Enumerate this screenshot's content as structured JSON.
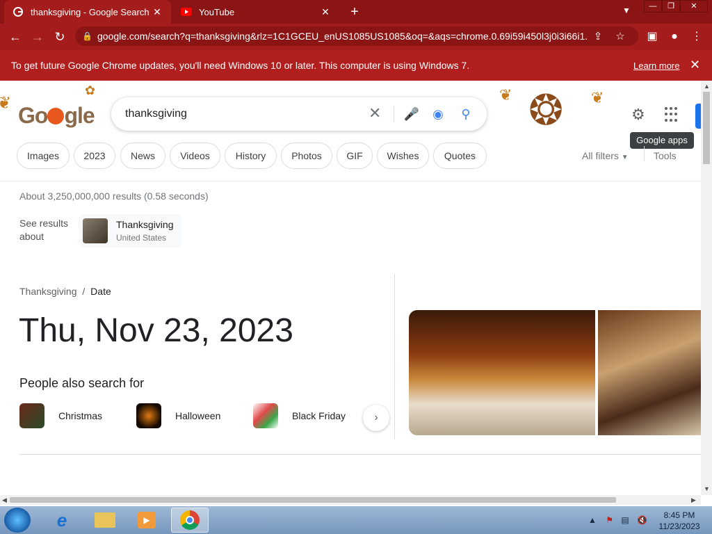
{
  "browser": {
    "tabs": [
      {
        "label": "thanksgiving - Google Search",
        "active": true,
        "favicon": "google-g-icon"
      },
      {
        "label": "YouTube",
        "active": false,
        "favicon": "youtube-icon"
      }
    ],
    "url": "google.com/search?q=thanksgiving&rlz=1C1GCEU_enUS1085US1085&oq=&aqs=chrome.0.69i59i450l3j0i3i66i1...",
    "theme_color": "#a51c1c"
  },
  "infobar": {
    "message": "To get future Google Chrome updates, you'll need Windows 10 or later. This computer is using Windows 7.",
    "link": "Learn more"
  },
  "search": {
    "query": "thanksgiving",
    "tooltip": "Google apps",
    "chips": [
      "Images",
      "2023",
      "News",
      "Videos",
      "History",
      "Photos",
      "GIF",
      "Wishes",
      "Quotes"
    ],
    "all_filters": "All filters",
    "tools": "Tools",
    "result_stats": "About 3,250,000,000 results (0.58 seconds)"
  },
  "see_results": {
    "label": "See results about",
    "entity_name": "Thanksgiving",
    "entity_sub": "United States"
  },
  "answer": {
    "breadcrumb_parent": "Thanksgiving",
    "breadcrumb_sep": "/",
    "breadcrumb_current": "Date",
    "date": "Thu, Nov 23, 2023"
  },
  "people_also_search": {
    "heading": "People also search for",
    "items": [
      "Christmas",
      "Halloween",
      "Black Friday"
    ]
  },
  "taskbar": {
    "time": "8:45 PM",
    "date": "11/23/2023"
  }
}
